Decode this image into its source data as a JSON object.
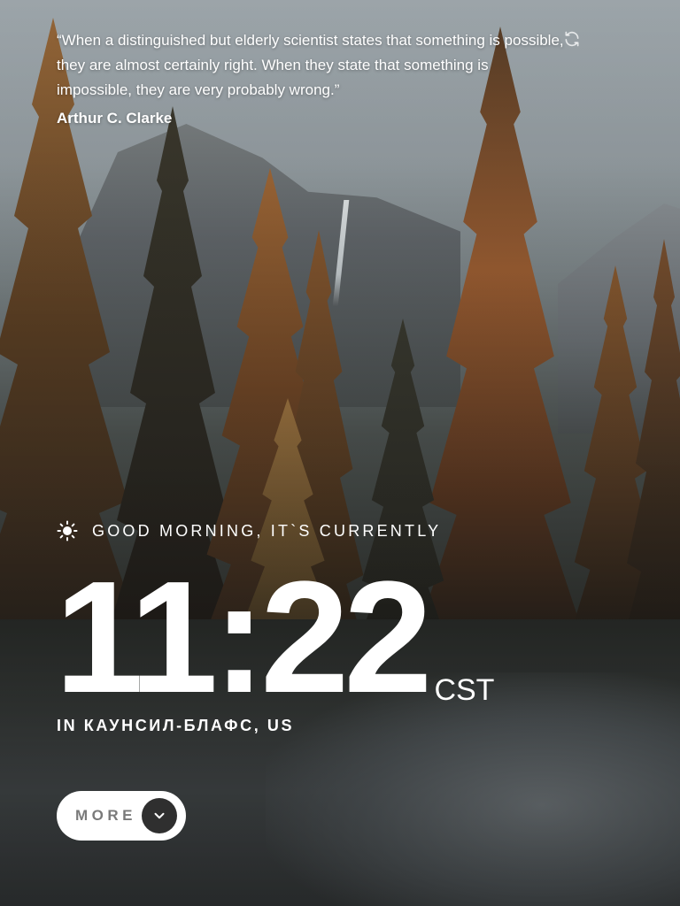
{
  "quote": {
    "text": "“When a distinguished but elderly scientist states that something is possible, they are almost certainly right. When they state that something is impossible, they are very probably wrong.”",
    "author": "Arthur C. Clarke",
    "refresh_icon": "refresh-icon"
  },
  "greeting": {
    "icon": "sun-icon",
    "text": "Good Morning, it`s currently"
  },
  "clock": {
    "time": "11:22",
    "timezone": "CST"
  },
  "location": {
    "text": "In Каунсил-Блафс, US"
  },
  "more_button": {
    "label": "MORE",
    "icon": "chevron-down-icon"
  },
  "colors": {
    "text": "#ffffff",
    "button_bg": "#ffffff",
    "button_label": "#7a7a7a",
    "chevron_bg": "#2f2f2f"
  }
}
